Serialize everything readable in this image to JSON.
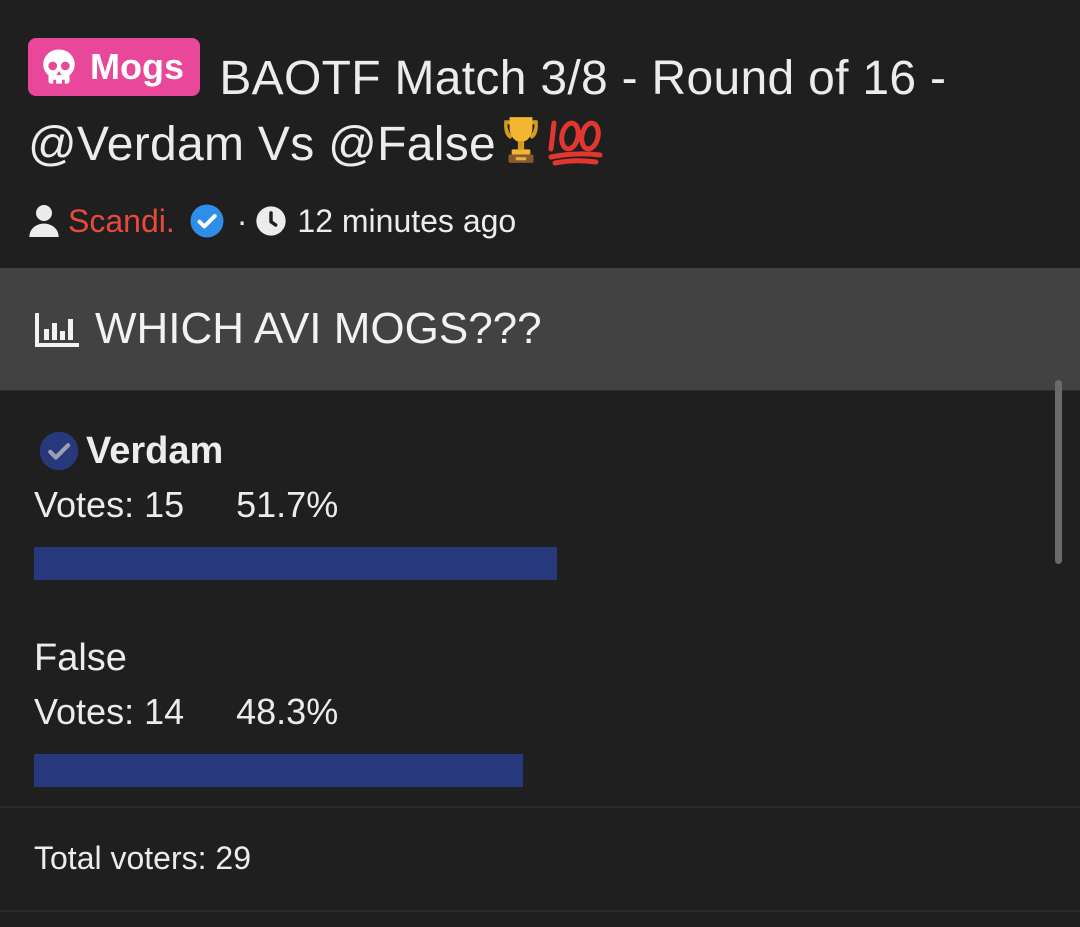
{
  "thread": {
    "prefix_label": "Mogs",
    "prefix_icon": "skull-icon",
    "prefix_color": "#e8479a",
    "title": "BAOTF Match 3/8 - Round of 16 - @Verdam Vs @False",
    "title_emojis": [
      "trophy-icon",
      "hundred-points-icon"
    ],
    "author": "Scandi.",
    "author_color": "#e64a3c",
    "author_verified": true,
    "meta_separator": "·",
    "posted_time": "12 minutes ago"
  },
  "poll": {
    "question": "WHICH AVI MOGS???",
    "bar_color": "#27397c",
    "options": [
      {
        "name": "Verdam",
        "votes_text": "Votes: 15",
        "percent_text": "51.7%",
        "percent": 51.7,
        "selected": true
      },
      {
        "name": "False",
        "votes_text": "Votes: 14",
        "percent_text": "48.3%",
        "percent": 48.3,
        "selected": false
      }
    ],
    "total_text": "Total voters: 29"
  }
}
